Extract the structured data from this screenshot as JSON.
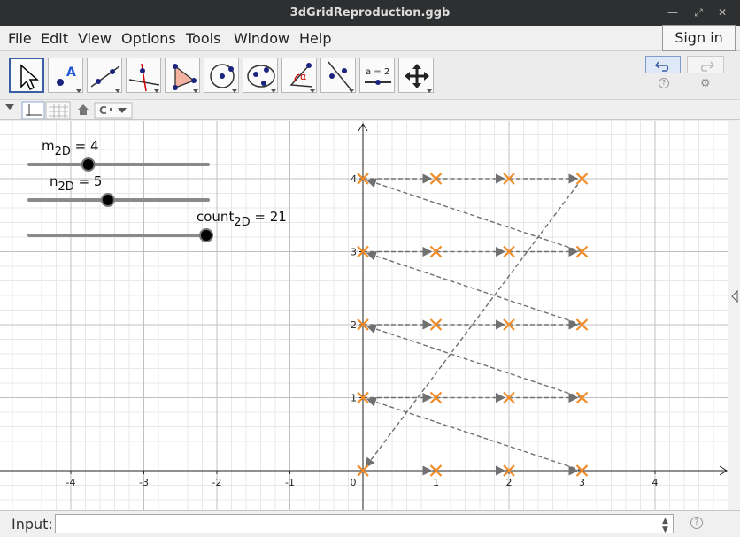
{
  "window": {
    "title": "3dGridReproduction.ggb"
  },
  "menubar": {
    "items": [
      "File",
      "Edit",
      "View",
      "Options",
      "Tools",
      "Window",
      "Help"
    ],
    "sign_in": "Sign in"
  },
  "toolbar": {
    "tools": [
      "move-tool",
      "point-tool",
      "line-tool",
      "perpendicular-line-tool",
      "polygon-tool",
      "circle-tool",
      "conic-tool",
      "angle-tool",
      "reflect-tool",
      "slider-tool",
      "move-graphics-view-tool"
    ],
    "slider_tool_label": "a = 2",
    "point_tool_label": "A",
    "angle_tool_label": "α"
  },
  "sliders": [
    {
      "name": "m",
      "sub": "2D",
      "value": 4,
      "min": 1,
      "max": 10
    },
    {
      "name": "n",
      "sub": "2D",
      "value": 5,
      "min": 1,
      "max": 10
    },
    {
      "name": "count",
      "sub": "2D",
      "value": 21,
      "min": 0,
      "max": 21
    }
  ],
  "axes": {
    "x_ticks": [
      "-4",
      "-3",
      "-2",
      "-1",
      "0",
      "1",
      "2",
      "3",
      "4"
    ],
    "y_ticks": [
      "1",
      "2",
      "3",
      "4"
    ]
  },
  "points": [
    [
      0,
      0
    ],
    [
      1,
      0
    ],
    [
      2,
      0
    ],
    [
      3,
      0
    ],
    [
      0,
      1
    ],
    [
      1,
      1
    ],
    [
      2,
      1
    ],
    [
      3,
      1
    ],
    [
      0,
      2
    ],
    [
      1,
      2
    ],
    [
      2,
      2
    ],
    [
      3,
      2
    ],
    [
      0,
      3
    ],
    [
      1,
      3
    ],
    [
      2,
      3
    ],
    [
      3,
      3
    ],
    [
      0,
      4
    ],
    [
      1,
      4
    ],
    [
      2,
      4
    ],
    [
      3,
      4
    ]
  ],
  "vectors": [
    [
      [
        0,
        0
      ],
      [
        1,
        0
      ]
    ],
    [
      [
        1,
        0
      ],
      [
        2,
        0
      ]
    ],
    [
      [
        2,
        0
      ],
      [
        3,
        0
      ]
    ],
    [
      [
        3,
        0
      ],
      [
        0,
        1
      ]
    ],
    [
      [
        0,
        1
      ],
      [
        1,
        1
      ]
    ],
    [
      [
        1,
        1
      ],
      [
        2,
        1
      ]
    ],
    [
      [
        2,
        1
      ],
      [
        3,
        1
      ]
    ],
    [
      [
        3,
        1
      ],
      [
        0,
        2
      ]
    ],
    [
      [
        0,
        2
      ],
      [
        1,
        2
      ]
    ],
    [
      [
        1,
        2
      ],
      [
        2,
        2
      ]
    ],
    [
      [
        2,
        2
      ],
      [
        3,
        2
      ]
    ],
    [
      [
        3,
        2
      ],
      [
        0,
        3
      ]
    ],
    [
      [
        0,
        3
      ],
      [
        1,
        3
      ]
    ],
    [
      [
        1,
        3
      ],
      [
        2,
        3
      ]
    ],
    [
      [
        2,
        3
      ],
      [
        3,
        3
      ]
    ],
    [
      [
        3,
        3
      ],
      [
        0,
        4
      ]
    ],
    [
      [
        0,
        4
      ],
      [
        1,
        4
      ]
    ],
    [
      [
        1,
        4
      ],
      [
        2,
        4
      ]
    ],
    [
      [
        2,
        4
      ],
      [
        3,
        4
      ]
    ],
    [
      [
        3,
        4
      ],
      [
        0,
        0
      ]
    ]
  ],
  "colors": {
    "point": "#f28c28",
    "vector": "#707070",
    "grid_minor": "#e8e8e8",
    "grid_major": "#c0c0c0"
  },
  "input": {
    "label": "Input:",
    "value": ""
  }
}
